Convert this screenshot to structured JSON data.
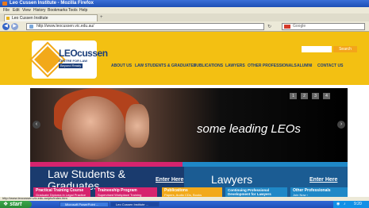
{
  "window": {
    "title": "Leo Cussen Institute - Mozilla Firefox"
  },
  "menu": [
    "File",
    "Edit",
    "View",
    "History",
    "Bookmarks",
    "Tools",
    "Help"
  ],
  "tab": {
    "label": "Leo Cussen Institute",
    "new_tab": "+"
  },
  "nav": {
    "url": "http://www.leocussen.vic.edu.au/",
    "search_placeholder": "Google"
  },
  "site": {
    "logo_name": "LEOcussen",
    "logo_sub": "CENTRE FOR LAW",
    "logo_tag": "Beyond Ready",
    "search_button": "Search",
    "menu": [
      "ABOUT US",
      "LAW STUDENTS & GRADUATES",
      "PUBLICATIONS",
      "LAWYERS",
      "OTHER PROFESSIONALS",
      "ALUMNI",
      "CONTACT US"
    ]
  },
  "hero": {
    "caption": "some leading LEOs",
    "pager": [
      "1",
      "2",
      "3",
      "4"
    ],
    "prev": "‹",
    "next": "›"
  },
  "panels": {
    "left_title": "Law Students & Graduates",
    "left_link": "Enter Here",
    "right_title": "Lawyers",
    "right_link": "Enter Here"
  },
  "cards": [
    {
      "title": "Practical Training Course",
      "sub": "Graduate Diploma in Legal Practice",
      "color": "#d6246e"
    },
    {
      "title": "Traineeship Program",
      "sub": "Supervised Workplace Training",
      "color": "#d6246e"
    },
    {
      "title": "Publications",
      "sub": "Papers, Audio CDs, Books",
      "color": "#f2a91a"
    },
    {
      "title": "Continuing Professional Development for Lawyers",
      "sub": "CPD",
      "color": "#1f88c7"
    },
    {
      "title": "Other Professionals",
      "sub": "Join Now ›",
      "color": "#1f88c7"
    }
  ],
  "status": {
    "text": "http://www.leocussen.vic.edu.au/ptc/index.htm"
  },
  "taskbar": {
    "start": "start",
    "tasks": [
      "Microsoft PowerPoint ...",
      "Leo Cussen Institute ..."
    ],
    "clock": "9:20"
  },
  "colors": {
    "header_yellow": "#f3c012",
    "brand_blue": "#1b3e7a",
    "magenta": "#d6246e",
    "cyan": "#1f88c7"
  }
}
